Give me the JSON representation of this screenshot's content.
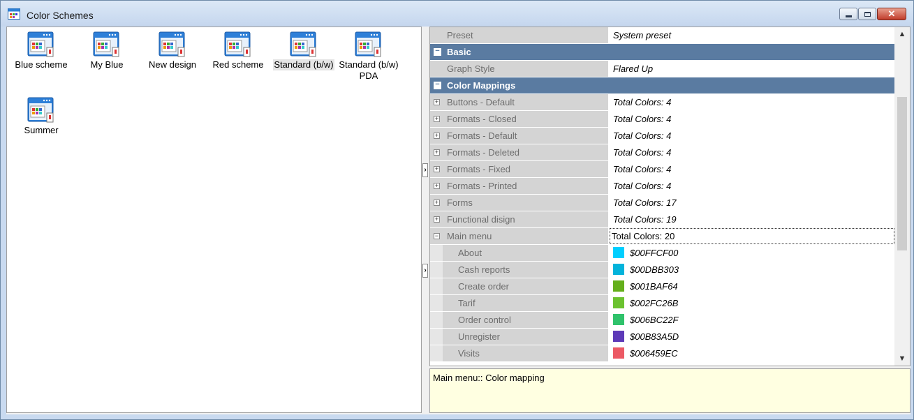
{
  "window": {
    "title": "Color Schemes",
    "close_glyph": "✕"
  },
  "schemes": [
    {
      "label": "Blue scheme"
    },
    {
      "label": "My Blue"
    },
    {
      "label": "New design"
    },
    {
      "label": "Red scheme"
    },
    {
      "label": "Standard (b/w)",
      "selected": true
    },
    {
      "label": "Standard (b/w) PDA"
    },
    {
      "label": "Summer"
    }
  ],
  "grid": {
    "preset": {
      "name": "Preset",
      "value": "System preset"
    },
    "basic": {
      "title": "Basic"
    },
    "graph_style": {
      "name": "Graph Style",
      "value": "Flared Up"
    },
    "color_mappings": {
      "title": "Color Mappings"
    },
    "mappings": [
      {
        "name": "Buttons - Default",
        "value": "Total Colors: 4"
      },
      {
        "name": "Formats - Closed",
        "value": "Total Colors: 4"
      },
      {
        "name": "Formats - Default",
        "value": "Total Colors: 4"
      },
      {
        "name": "Formats - Deleted",
        "value": "Total Colors: 4"
      },
      {
        "name": "Formats - Fixed",
        "value": "Total Colors: 4"
      },
      {
        "name": "Formats - Printed",
        "value": "Total Colors: 4"
      },
      {
        "name": "Forms",
        "value": "Total Colors: 17"
      },
      {
        "name": "Functional disign",
        "value": "Total Colors: 19"
      }
    ],
    "main_menu": {
      "name": "Main menu",
      "value": "Total Colors: 20"
    },
    "menu_items": [
      {
        "name": "About",
        "value": "$00FFCF00",
        "color": "#00cfff"
      },
      {
        "name": "Cash reports",
        "value": "$00DBB303",
        "color": "#03b3db"
      },
      {
        "name": "Create order",
        "value": "$001BAF64",
        "color": "#64af1b"
      },
      {
        "name": "Tarif",
        "value": "$002FC26B",
        "color": "#6bc22f"
      },
      {
        "name": "Order control",
        "value": "$006BC22F",
        "color": "#2fc26b"
      },
      {
        "name": "Unregister",
        "value": "$00B83A5D",
        "color": "#5d3ab8"
      },
      {
        "name": "Visits",
        "value": "$006459EC",
        "color": "#ec5964"
      }
    ]
  },
  "description": "Main menu:: Color mapping"
}
